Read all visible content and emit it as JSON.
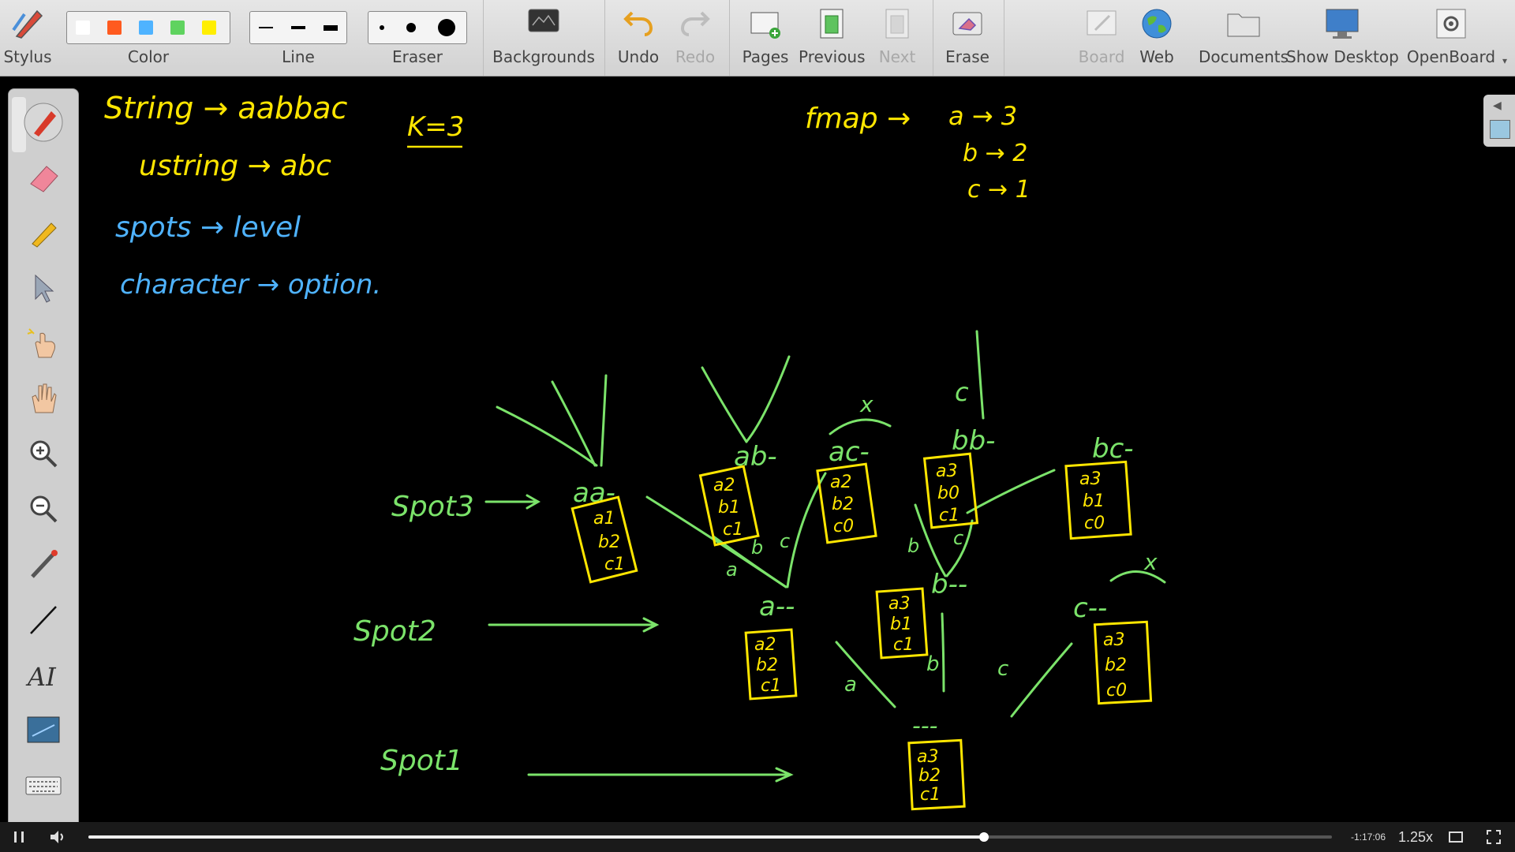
{
  "toolbar": {
    "stylus": "Stylus",
    "color": "Color",
    "line": "Line",
    "eraser": "Eraser",
    "backgrounds": "Backgrounds",
    "undo": "Undo",
    "redo": "Redo",
    "pages": "Pages",
    "previous": "Previous",
    "next": "Next",
    "erase": "Erase",
    "board": "Board",
    "web": "Web",
    "documents": "Documents",
    "show_desktop": "Show Desktop",
    "openboard": "OpenBoard",
    "colors": [
      "#ffffff",
      "#ff5a1f",
      "#4fb3ff",
      "#5fd35f",
      "#ffee00"
    ]
  },
  "board": {
    "yellow_notes": {
      "string": "String → aabbac",
      "ustring": "ustring → abc",
      "k": "K=3",
      "fmap": "fmap →",
      "fa": "a → 3",
      "fb": "b → 2",
      "fc": "c → 1"
    },
    "blue_notes": {
      "spots": "spots → level",
      "character": "character → option."
    },
    "green_labels": {
      "spot3": "Spot3",
      "spot2": "Spot2",
      "spot1": "Spot1",
      "aa": "aa-",
      "ab": "ab-",
      "ac": "ac-",
      "bb": "bb-",
      "bc": "bc-",
      "a": "a--",
      "b": "b--",
      "c": "c--",
      "root": "---",
      "x": "x",
      "c_top": "c"
    },
    "boxes": {
      "aa": [
        "a1",
        "b2",
        "c1"
      ],
      "ab": [
        "a2",
        "b1",
        "c1"
      ],
      "ac": [
        "a2",
        "b2",
        "c0"
      ],
      "bb": [
        "a3",
        "b0",
        "c1"
      ],
      "bc": [
        "a3",
        "b1",
        "c0"
      ],
      "a": [
        "a2",
        "b2",
        "c1"
      ],
      "b": [
        "a3",
        "b1",
        "c1"
      ],
      "c": [
        "a3",
        "b2",
        "c0"
      ],
      "root": [
        "a3",
        "b2",
        "c1"
      ]
    }
  },
  "player": {
    "time": "-1:17:06",
    "speed": "1.25x",
    "progress": 0.72
  }
}
